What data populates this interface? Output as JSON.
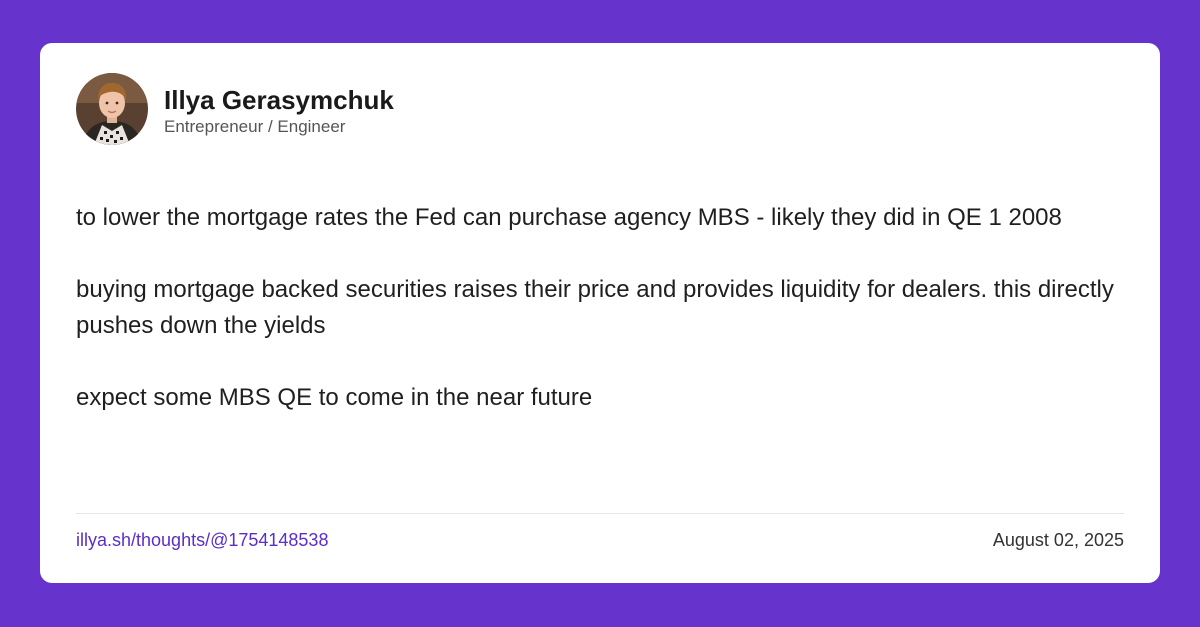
{
  "author": {
    "name": "Illya Gerasymchuk",
    "role": "Entrepreneur / Engineer"
  },
  "post": {
    "paragraphs": [
      "to lower the mortgage rates the Fed can purchase agency MBS - likely they did in QE 1 2008",
      "buying mortgage backed securities raises their price and provides liquidity for dealers. this directly pushes down the yields",
      "expect some MBS QE to come in the near future"
    ]
  },
  "footer": {
    "link": "illya.sh/thoughts/@1754148538",
    "date": "August 02, 2025"
  },
  "colors": {
    "background": "#6633cc",
    "card": "#ffffff",
    "link": "#5b2ec9"
  }
}
